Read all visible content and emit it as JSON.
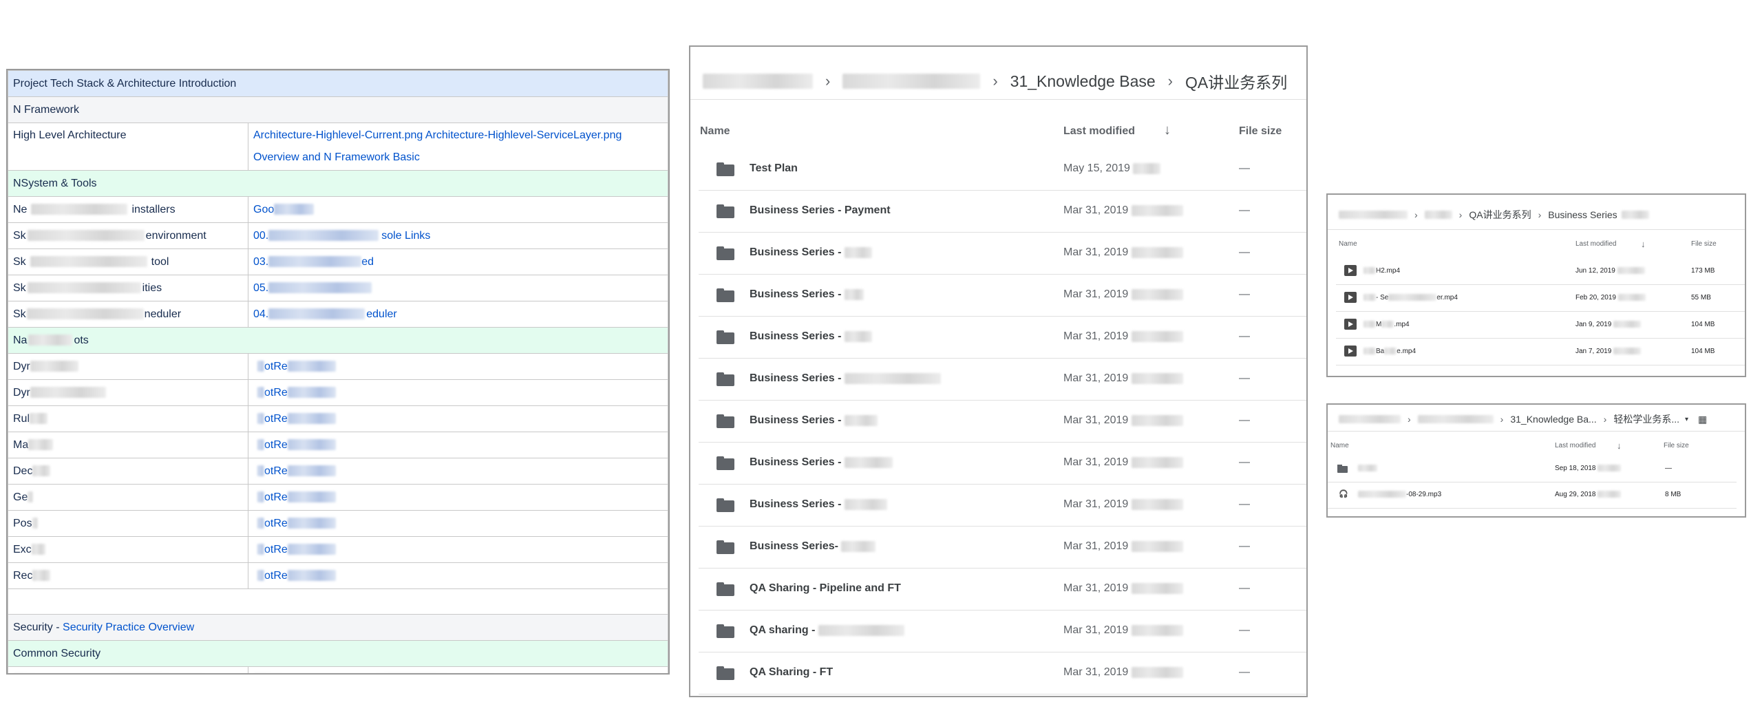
{
  "wiki": {
    "title_row": "Project Tech Stack & Architecture Introduction",
    "n_framework": "N Framework",
    "high_level": {
      "label": "High Level Architecture",
      "link1": "Architecture-Highlevel-Current.png",
      "link2": "Architecture-Highlevel-ServiceLayer.png",
      "link3": "Overview and N Framework Basic"
    },
    "nsystem": "NSystem & Tools",
    "tools": [
      {
        "left_start": "Ne",
        "left_end": "installers",
        "right_start": "Goo",
        "right_end": ""
      },
      {
        "left_start": "Sk",
        "left_end": "environment",
        "right_start": "00.",
        "right_end": "sole Links"
      },
      {
        "left_start": "Sk",
        "left_end": "tool",
        "right_start": "03.",
        "right_end": "ed"
      },
      {
        "left_start": "Sk",
        "left_end": "ities",
        "right_start": "05.",
        "right_end": ""
      },
      {
        "left_start": "Sk",
        "left_end": "neduler",
        "right_start": "04.",
        "right_end": "eduler"
      }
    ],
    "na_section": {
      "start": "Na",
      "end": "ots"
    },
    "bots": [
      {
        "left": "Dyr",
        "right": "otRe"
      },
      {
        "left": "Dyr",
        "right": "otRe"
      },
      {
        "left": "Rul",
        "right": "otRe"
      },
      {
        "left": "Ma",
        "right": "otRe"
      },
      {
        "left": "Dec",
        "right": "otRe"
      },
      {
        "left": "Ge",
        "right": "otRe"
      },
      {
        "left": "Pos",
        "right": "otRe"
      },
      {
        "left": "Exc",
        "right": "otRe"
      },
      {
        "left": "Rec",
        "right": "otRe"
      }
    ],
    "security_label": "Security - ",
    "security_link": "Security Practice Overview",
    "common_security": "Common Security"
  },
  "drive": {
    "crumbs": [
      "31_Knowledge Base",
      "QA讲业务系列"
    ],
    "col_name": "Name",
    "col_modified": "Last modified",
    "col_size": "File size",
    "rows": [
      {
        "name": "Test Plan",
        "date": "May 15, 2019",
        "size": "—"
      },
      {
        "name": "Business Series - Payment",
        "date": "Mar 31, 2019",
        "size": "—"
      },
      {
        "name": "Business Series - ",
        "date": "Mar 31, 2019",
        "size": "—"
      },
      {
        "name": "Business Series - ",
        "date": "Mar 31, 2019",
        "size": "—"
      },
      {
        "name": "Business Series - ",
        "date": "Mar 31, 2019",
        "size": "—"
      },
      {
        "name": "Business Series - ",
        "date": "Mar 31, 2019",
        "size": "—"
      },
      {
        "name": "Business Series - ",
        "date": "Mar 31, 2019",
        "size": "—"
      },
      {
        "name": "Business Series - ",
        "date": "Mar 31, 2019",
        "size": "—"
      },
      {
        "name": "Business Series - ",
        "date": "Mar 31, 2019",
        "size": "—"
      },
      {
        "name": "Business Series- ",
        "date": "Mar 31, 2019",
        "size": "—"
      },
      {
        "name": "QA Sharing - Pipeline and FT",
        "date": "Mar 31, 2019",
        "size": "—"
      },
      {
        "name": "QA sharing - ",
        "date": "Mar 31, 2019",
        "size": "—"
      },
      {
        "name": "QA Sharing - FT",
        "date": "Mar 31, 2019",
        "size": "—"
      }
    ]
  },
  "panel1": {
    "crumbs": [
      "QA讲业务系列",
      "Business Series"
    ],
    "col_name": "Name",
    "col_modified": "Last modified",
    "col_size": "File size",
    "rows": [
      {
        "name": "H2.mp4",
        "date": "Jun 12, 2019",
        "size": "173 MB"
      },
      {
        "name": "- Se",
        "name_end": "er.mp4",
        "date": "Feb 20, 2019",
        "size": "55 MB"
      },
      {
        "name": "M",
        "name_end": ".mp4",
        "date": "Jan 9, 2019",
        "size": "104 MB"
      },
      {
        "name": "Ba",
        "name_end": "e.mp4",
        "date": "Jan 7, 2019",
        "size": "104 MB"
      }
    ]
  },
  "panel2": {
    "crumbs": [
      "31_Knowledge Ba...",
      "轻松学业务系..."
    ],
    "col_name": "Name",
    "col_modified": "Last modified",
    "col_size": "File size",
    "rows": [
      {
        "name": "",
        "date": "Sep 18, 2018",
        "size": "—"
      },
      {
        "name": "-08-29.mp3",
        "date": "Aug 29, 2018",
        "size": "8 MB"
      }
    ]
  }
}
